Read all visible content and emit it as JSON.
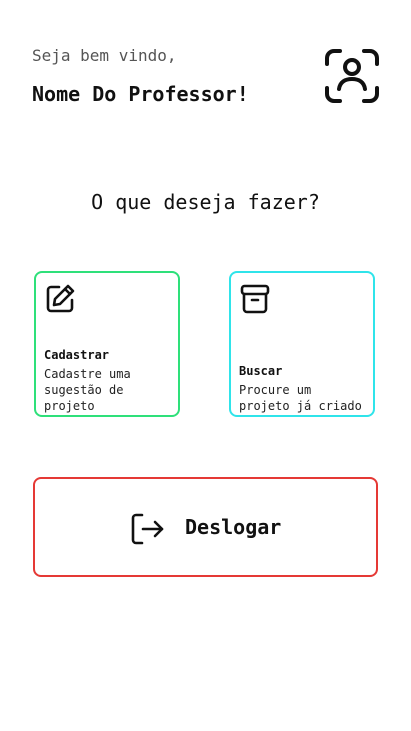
{
  "header": {
    "greeting": "Seja bem vindo,",
    "user_name": "Nome Do Professor!",
    "profile_icon": "face-id-user-icon"
  },
  "main": {
    "question": "O que deseja fazer?",
    "actions": [
      {
        "title": "Cadastrar",
        "description": "Cadastre uma sugestão de projeto",
        "icon": "edit-square-icon",
        "border_color": "#2ee07a"
      },
      {
        "title": "Buscar",
        "description": "Procure um projeto já criado",
        "icon": "archive-box-icon",
        "border_color": "#2fe4ea"
      }
    ],
    "logout": {
      "label": "Deslogar",
      "icon": "logout-icon",
      "border_color": "#e53935"
    }
  }
}
